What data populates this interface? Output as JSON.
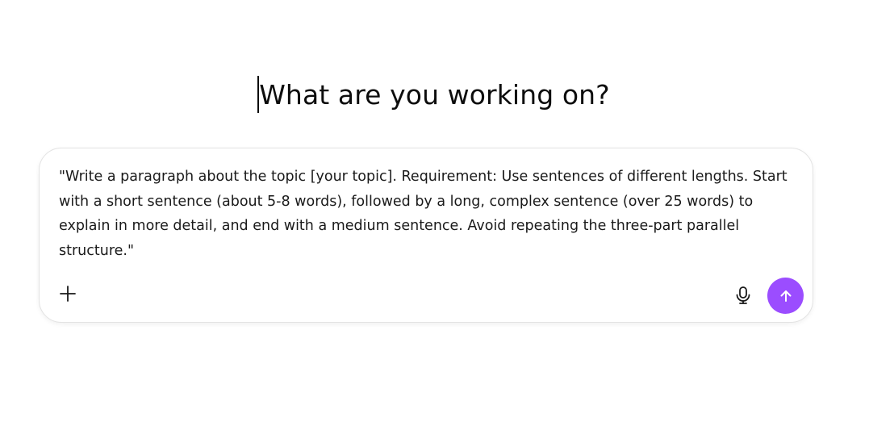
{
  "main": {
    "headline": "What are you working on?"
  },
  "composer": {
    "prompt_value": "\"Write a paragraph about the topic [your topic]. Requirement: Use sentences of different lengths. Start with a short sentence (about 5-8 words), followed by a long, complex sentence (over 25 words) to explain in more detail, and end with a medium sentence. Avoid repeating the three-part parallel structure.\"",
    "add_icon": "plus-icon",
    "mic_icon": "microphone-icon",
    "send_icon": "arrow-up-icon"
  },
  "colors": {
    "send_button": "#9b4dff",
    "text": "#0d0d0d",
    "border": "#e3e3e3"
  }
}
